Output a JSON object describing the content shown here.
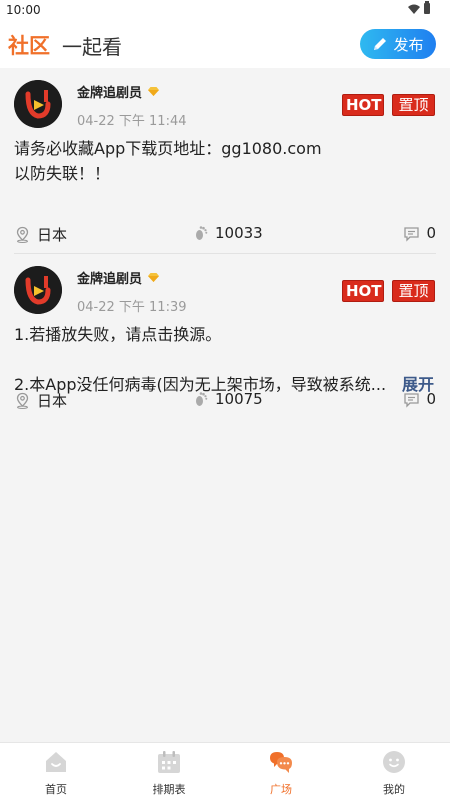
{
  "status_bar": {
    "time": "10:00"
  },
  "header": {
    "tab_community": "社区",
    "tab_watch": "一起看",
    "publish_label": "发布"
  },
  "posts": [
    {
      "author": "金牌追剧员",
      "time": "04-22 下午 11:44",
      "badge_hot": "HOT",
      "badge_top": "置顶",
      "content_lines": [
        "请务必收藏App下载页地址：gg1080.com",
        "以防失联！！"
      ],
      "location": "日本",
      "views": "10033",
      "comments": "0"
    },
    {
      "author": "金牌追剧员",
      "time": "04-22 下午 11:39",
      "badge_hot": "HOT",
      "badge_top": "置顶",
      "content_lines": [
        "1.若播放失败，请点击换源。",
        "2.本App没任何病毒(因为无上架市场，导致被系统..."
      ],
      "expand_label": "展开",
      "location": "日本",
      "views": "10075",
      "comments": "0"
    }
  ],
  "bottom_nav": {
    "home": "首页",
    "schedule": "排期表",
    "square": "广场",
    "mine": "我的"
  },
  "colors": {
    "accent": "#f0702a",
    "publish_gradient_start": "#2fb9f0",
    "publish_gradient_end": "#1f7ff0",
    "badge_red": "#d92b1c",
    "expand_link": "#3d5a8a"
  }
}
